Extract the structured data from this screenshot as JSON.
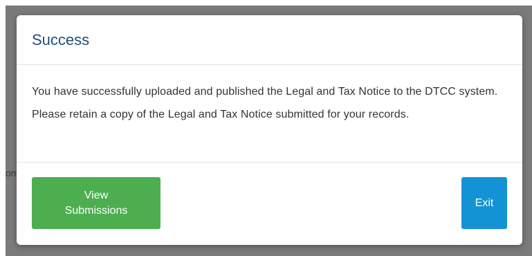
{
  "background": {
    "partial_text": "om"
  },
  "dialog": {
    "title": "Success",
    "message": "You have successfully uploaded and published the Legal and Tax Notice to the DTCC system. Please retain a copy of the Legal and Tax Notice submitted for your records.",
    "buttons": {
      "view_submissions": "View Submissions",
      "exit": "Exit"
    }
  },
  "colors": {
    "title": "#1f4e79",
    "view_button": "#4cae4f",
    "exit_button": "#1393d4",
    "overlay": "#7a7a7a"
  }
}
